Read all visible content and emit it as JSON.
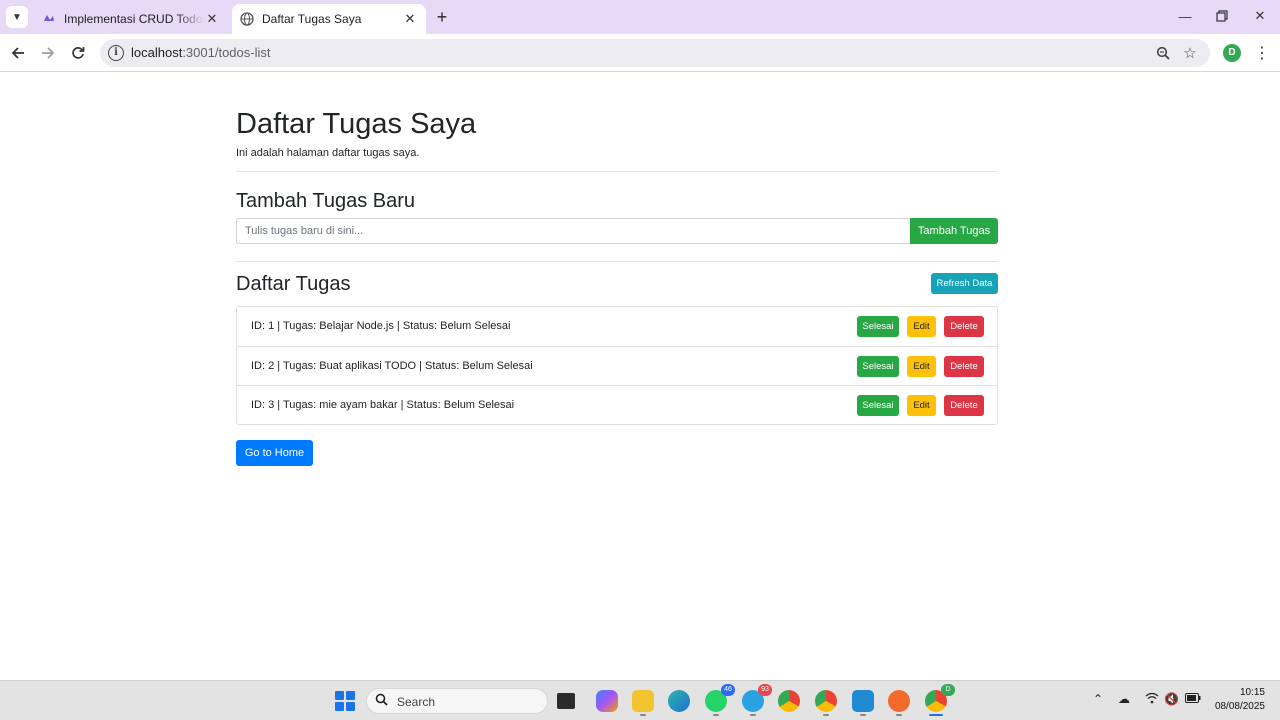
{
  "browser": {
    "tabs": [
      {
        "title": "Implementasi CRUD Todos dengan",
        "active": false,
        "icon": "cloud-app-icon"
      },
      {
        "title": "Daftar Tugas Saya",
        "active": true,
        "icon": "globe-icon"
      }
    ],
    "url_host": "localhost",
    "url_path": ":3001/todos-list",
    "profile_initial": "D"
  },
  "page": {
    "title": "Daftar Tugas Saya",
    "subtitle": "Ini adalah halaman daftar tugas saya.",
    "add_section": {
      "heading": "Tambah Tugas Baru",
      "input_placeholder": "Tulis tugas baru di sini...",
      "input_value": "",
      "button_label": "Tambah Tugas"
    },
    "list_section": {
      "heading": "Daftar Tugas",
      "refresh_label": "Refresh Data",
      "items": [
        {
          "text": "ID: 1 | Tugas: Belajar Node.js | Status: Belum Selesai"
        },
        {
          "text": "ID: 2 | Tugas: Buat aplikasi TODO | Status: Belum Selesai"
        },
        {
          "text": "ID: 3 | Tugas: mie ayam bakar | Status: Belum Selesai"
        }
      ],
      "done_label": "Selesai",
      "edit_label": "Edit",
      "delete_label": "Delete"
    },
    "home_button_label": "Go to Home"
  },
  "taskbar": {
    "search_label": "Search",
    "whatsapp_badge": "46",
    "telegram_badge": "93",
    "chrome_profile_badge": "D",
    "time": "10:15",
    "date": "08/08/2025"
  },
  "colors": {
    "success": "#28a745",
    "warning": "#ffc107",
    "danger": "#dc3545",
    "info": "#17a2b8",
    "primary": "#007bff",
    "tabstrip": "#e8d9f6"
  }
}
